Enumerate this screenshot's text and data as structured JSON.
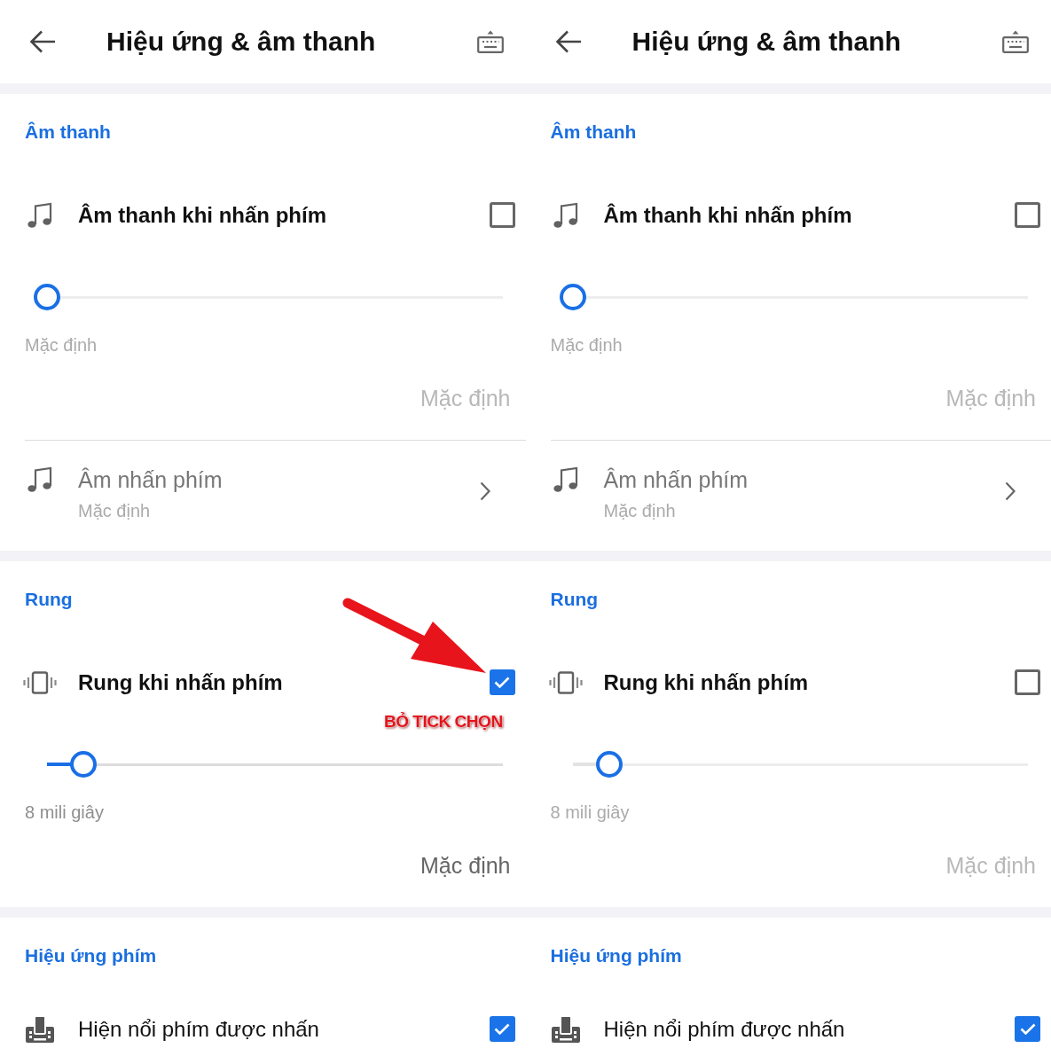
{
  "panels": [
    {
      "header": {
        "title": "Hiệu ứng & âm thanh"
      },
      "sections": [
        {
          "title": "Âm thanh",
          "items": [
            {
              "kind": "master",
              "label": "Âm thanh khi nhấn phím",
              "checked": false
            },
            {
              "kind": "slider",
              "level": 0,
              "value": "Mặc định",
              "reset": "Mặc định",
              "disabled": true
            },
            {
              "kind": "link",
              "label": "Âm nhấn phím",
              "sublabel": "Mặc định",
              "disabled": true
            }
          ]
        },
        {
          "title": "Rung",
          "items": [
            {
              "kind": "master",
              "label": "Rung khi nhấn phím",
              "checked": true
            },
            {
              "kind": "slider",
              "level": 0.08,
              "value": "8 mili giây",
              "reset": "Mặc định",
              "disabled": false
            }
          ]
        },
        {
          "title": "Hiệu ứng phím",
          "items": [
            {
              "kind": "toggle",
              "label": "Hiện nổi phím được nhấn",
              "checked": true
            }
          ]
        }
      ],
      "annotation": {
        "label": "BỎ TICK CHỌN"
      }
    },
    {
      "header": {
        "title": "Hiệu ứng & âm thanh"
      },
      "sections": [
        {
          "title": "Âm thanh",
          "items": [
            {
              "kind": "master",
              "label": "Âm thanh khi nhấn phím",
              "checked": false
            },
            {
              "kind": "slider",
              "level": 0,
              "value": "Mặc định",
              "reset": "Mặc định",
              "disabled": true
            },
            {
              "kind": "link",
              "label": "Âm nhấn phím",
              "sublabel": "Mặc định",
              "disabled": true
            }
          ]
        },
        {
          "title": "Rung",
          "items": [
            {
              "kind": "master",
              "label": "Rung khi nhấn phím",
              "checked": false
            },
            {
              "kind": "slider",
              "level": 0.08,
              "value": "8 mili giây",
              "reset": "Mặc định",
              "disabled": true
            }
          ]
        },
        {
          "title": "Hiệu ứng phím",
          "items": [
            {
              "kind": "toggle",
              "label": "Hiện nổi phím được nhấn",
              "checked": true
            }
          ]
        }
      ]
    }
  ]
}
